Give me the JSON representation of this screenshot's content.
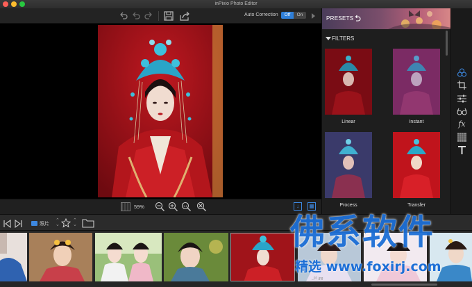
{
  "window": {
    "title": "inPixio Photo Editor"
  },
  "toolbar": {
    "auto_correction_label": "Auto Correction",
    "off_label": "Off",
    "on_label": "On",
    "icons": [
      "undo-icon",
      "undo-step-icon",
      "redo-icon",
      "save-icon",
      "share-icon",
      "play-icon"
    ]
  },
  "zoom": {
    "value": "59%"
  },
  "panel": {
    "presets_label": "PRESETS",
    "filters_label": "FILTERS",
    "filters": [
      {
        "label": "Linear"
      },
      {
        "label": "Instant"
      },
      {
        "label": "Process"
      },
      {
        "label": "Transfer"
      }
    ]
  },
  "tools": [
    "paint-icon",
    "crop-icon",
    "adjust-sliders-icon",
    "glasses-icon",
    "fx-icon",
    "texture-grid-icon",
    "text-icon"
  ],
  "browser": {
    "folder_label": "照片"
  },
  "filmstrip": {
    "partial_filename": "_07.jpg"
  },
  "watermark": {
    "title": "佛系软件",
    "url": "精选 www.foxirj.com"
  },
  "colors": {
    "accent": "#2f7fd8",
    "watermark": "#1d6fd6"
  }
}
